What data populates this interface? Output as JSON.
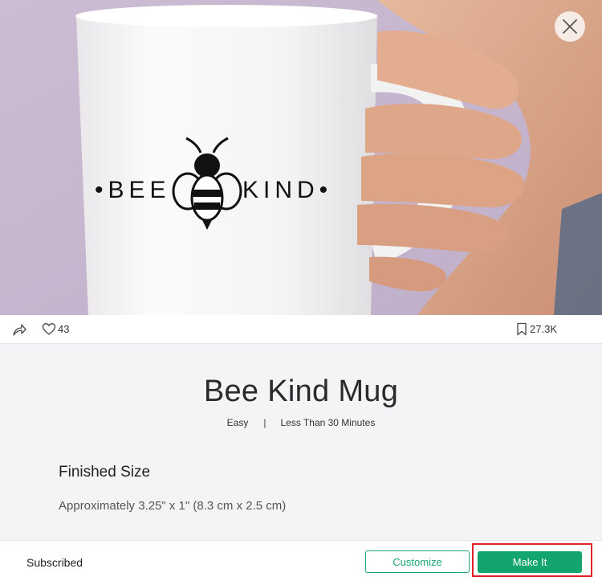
{
  "hero": {
    "image_text_left": "BEE",
    "image_text_right": "KIND",
    "carousel_dots": 2,
    "active_dot": 0,
    "close_icon": "close-icon"
  },
  "actions": {
    "share_icon": "share-icon",
    "like_icon": "heart-icon",
    "like_count": "43",
    "save_icon": "bookmark-icon",
    "save_count": "27.3K"
  },
  "project": {
    "title": "Bee Kind Mug",
    "difficulty": "Easy",
    "separator": "|",
    "duration": "Less Than 30 Minutes"
  },
  "details": {
    "heading": "Finished Size",
    "body": "Approximately 3.25\" x 1\" (8.3 cm x 2.5 cm)"
  },
  "footer": {
    "status": "Subscribed",
    "customize_label": "Customize",
    "makeit_label": "Make It"
  },
  "colors": {
    "accent": "#12a56e",
    "highlight": "#e0202a"
  }
}
